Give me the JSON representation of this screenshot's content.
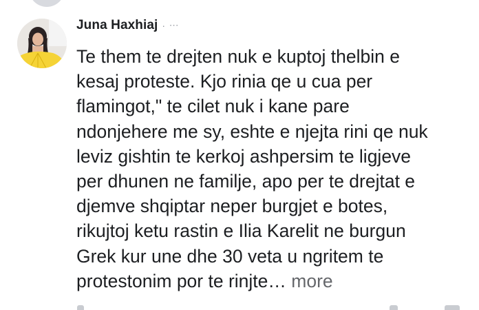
{
  "comment": {
    "author": "Juna Haxhiaj",
    "meta": "· ᐧᐧᐧ",
    "text": "Te them te drejten nuk e kuptoj thelbin e\nkesaj proteste. Kjo rinia qe u cua per\nflamingot,\" te cilet nuk i kane pare\nndonjehere me sy, eshte e njejta rini qe nuk\nleviz gishtin te kerkoj ashpersim te ligjeve\nper dhunen ne familje, apo per te drejtat e\ndjemve shqiptar neper burgjet e botes,\nrikujtoj ketu rastin e Ilia Karelit ne burgun\nGrek kur une dhe 30 veta u ngritem te\nprotestonim por te rinjte…",
    "more_label": "more"
  },
  "colors": {
    "text": "#1c1e21",
    "secondary": "#65676b",
    "avatar_accent": "#f2c81e"
  }
}
